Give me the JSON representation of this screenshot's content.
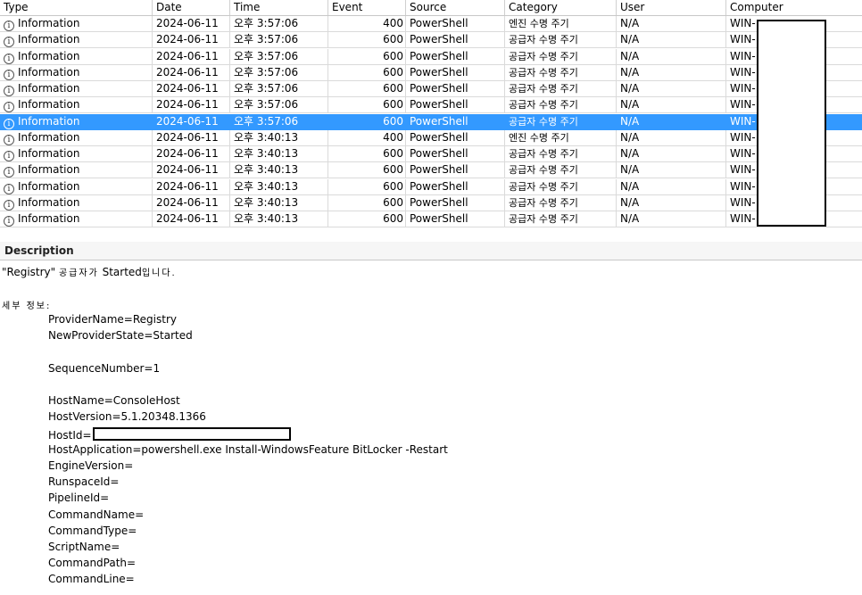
{
  "columns": {
    "type": "Type",
    "date": "Date",
    "time": "Time",
    "event": "Event",
    "source": "Source",
    "category": "Category",
    "user": "User",
    "computer": "Computer"
  },
  "rows": [
    {
      "type": "Information",
      "date": "2024-06-11",
      "time": "오후 3:57:06",
      "event": "400",
      "source": "PowerShell",
      "category": "엔진 수명 주기",
      "user": "N/A",
      "computer": "WIN-"
    },
    {
      "type": "Information",
      "date": "2024-06-11",
      "time": "오후 3:57:06",
      "event": "600",
      "source": "PowerShell",
      "category": "공급자 수명 주기",
      "user": "N/A",
      "computer": "WIN-"
    },
    {
      "type": "Information",
      "date": "2024-06-11",
      "time": "오후 3:57:06",
      "event": "600",
      "source": "PowerShell",
      "category": "공급자 수명 주기",
      "user": "N/A",
      "computer": "WIN-"
    },
    {
      "type": "Information",
      "date": "2024-06-11",
      "time": "오후 3:57:06",
      "event": "600",
      "source": "PowerShell",
      "category": "공급자 수명 주기",
      "user": "N/A",
      "computer": "WIN-"
    },
    {
      "type": "Information",
      "date": "2024-06-11",
      "time": "오후 3:57:06",
      "event": "600",
      "source": "PowerShell",
      "category": "공급자 수명 주기",
      "user": "N/A",
      "computer": "WIN-"
    },
    {
      "type": "Information",
      "date": "2024-06-11",
      "time": "오후 3:57:06",
      "event": "600",
      "source": "PowerShell",
      "category": "공급자 수명 주기",
      "user": "N/A",
      "computer": "WIN-"
    },
    {
      "type": "Information",
      "date": "2024-06-11",
      "time": "오후 3:57:06",
      "event": "600",
      "source": "PowerShell",
      "category": "공급자 수명 주기",
      "user": "N/A",
      "computer": "WIN-",
      "selected": true
    },
    {
      "type": "Information",
      "date": "2024-06-11",
      "time": "오후 3:40:13",
      "event": "400",
      "source": "PowerShell",
      "category": "엔진 수명 주기",
      "user": "N/A",
      "computer": "WIN-"
    },
    {
      "type": "Information",
      "date": "2024-06-11",
      "time": "오후 3:40:13",
      "event": "600",
      "source": "PowerShell",
      "category": "공급자 수명 주기",
      "user": "N/A",
      "computer": "WIN-"
    },
    {
      "type": "Information",
      "date": "2024-06-11",
      "time": "오후 3:40:13",
      "event": "600",
      "source": "PowerShell",
      "category": "공급자 수명 주기",
      "user": "N/A",
      "computer": "WIN-"
    },
    {
      "type": "Information",
      "date": "2024-06-11",
      "time": "오후 3:40:13",
      "event": "600",
      "source": "PowerShell",
      "category": "공급자 수명 주기",
      "user": "N/A",
      "computer": "WIN-"
    },
    {
      "type": "Information",
      "date": "2024-06-11",
      "time": "오후 3:40:13",
      "event": "600",
      "source": "PowerShell",
      "category": "공급자 수명 주기",
      "user": "N/A",
      "computer": "WIN-"
    },
    {
      "type": "Information",
      "date": "2024-06-11",
      "time": "오후 3:40:13",
      "event": "600",
      "source": "PowerShell",
      "category": "공급자 수명 주기",
      "user": "N/A",
      "computer": "WIN-"
    }
  ],
  "info_icon": "info-circle-icon",
  "selection_color": "#3399ff",
  "description": {
    "title": "Description",
    "summary_prefix": "\"Registry\" ",
    "summary_ko1": "공급자가",
    "summary_mid": " Started",
    "summary_ko2": "입니다.",
    "details_heading": "세부 정보:",
    "provider_name": "ProviderName=Registry",
    "new_provider_state": "NewProviderState=Started",
    "sequence_number": "SequenceNumber=1",
    "host_name": "HostName=ConsoleHost",
    "host_version": "HostVersion=5.1.20348.1366",
    "host_id": "HostId=",
    "host_application": "HostApplication=powershell.exe Install-WindowsFeature BitLocker -Restart",
    "engine_version": "EngineVersion=",
    "runspace_id": "RunspaceId=",
    "pipeline_id": "PipelineId=",
    "command_name": "CommandName=",
    "command_type": "CommandType=",
    "script_name": "ScriptName=",
    "command_path": "CommandPath=",
    "command_line": "CommandLine="
  }
}
